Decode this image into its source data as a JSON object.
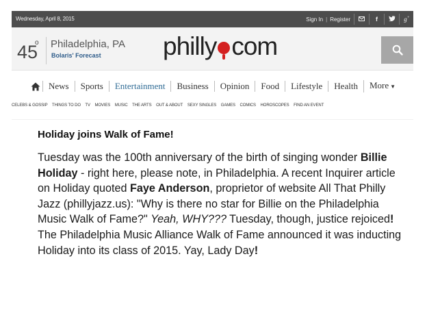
{
  "topbar": {
    "date": "Wednesday, April 8, 2015",
    "sign_in": "Sign In",
    "separator": "|",
    "register": "Register",
    "icons": [
      "mail-icon",
      "facebook-icon",
      "twitter-icon",
      "google-plus-icon"
    ]
  },
  "weather": {
    "temp": "45",
    "degree": "o",
    "city": "Philadelphia, PA",
    "forecast": "Bolaris' Forecast"
  },
  "logo": {
    "left": "philly",
    "right": "com"
  },
  "nav": {
    "items": [
      "News",
      "Sports",
      "Entertainment",
      "Business",
      "Opinion",
      "Food",
      "Lifestyle",
      "Health",
      "More"
    ],
    "active_color": "#2e6a94"
  },
  "subnav": [
    "CELEBS & GOSSIP",
    "THINGS TO DO",
    "TV",
    "MOVIES",
    "MUSIC",
    "THE ARTS",
    "OUT & ABOUT",
    "SEXY SINGLES",
    "GAMES",
    "COMICS",
    "HOROSCOPES",
    "FIND AN EVENT"
  ],
  "article": {
    "headline": "Holiday joins Walk of Fame!",
    "p1": "Tuesday was the 100th anniversary of the birth of singing wonder ",
    "b1": "Billie Holiday",
    "p2": " - right here, please note, in Philadelphia. A recent Inquirer article on Holiday quoted ",
    "b2": "Faye Anderson",
    "p3": ", proprietor of website All That Philly Jazz (phillyjazz.us): \"Why is there no star for Billie on the Philadelphia Music Walk of Fame?\" ",
    "i1": "Yeah, WHY???",
    "p4": " Tuesday, though, justice rejoiced",
    "b3": "!",
    "p5": " The Philadelphia Music Alliance Walk of Fame announced it was inducting Holiday into its class of 2015. Yay, Lady Day",
    "b4": "!"
  }
}
